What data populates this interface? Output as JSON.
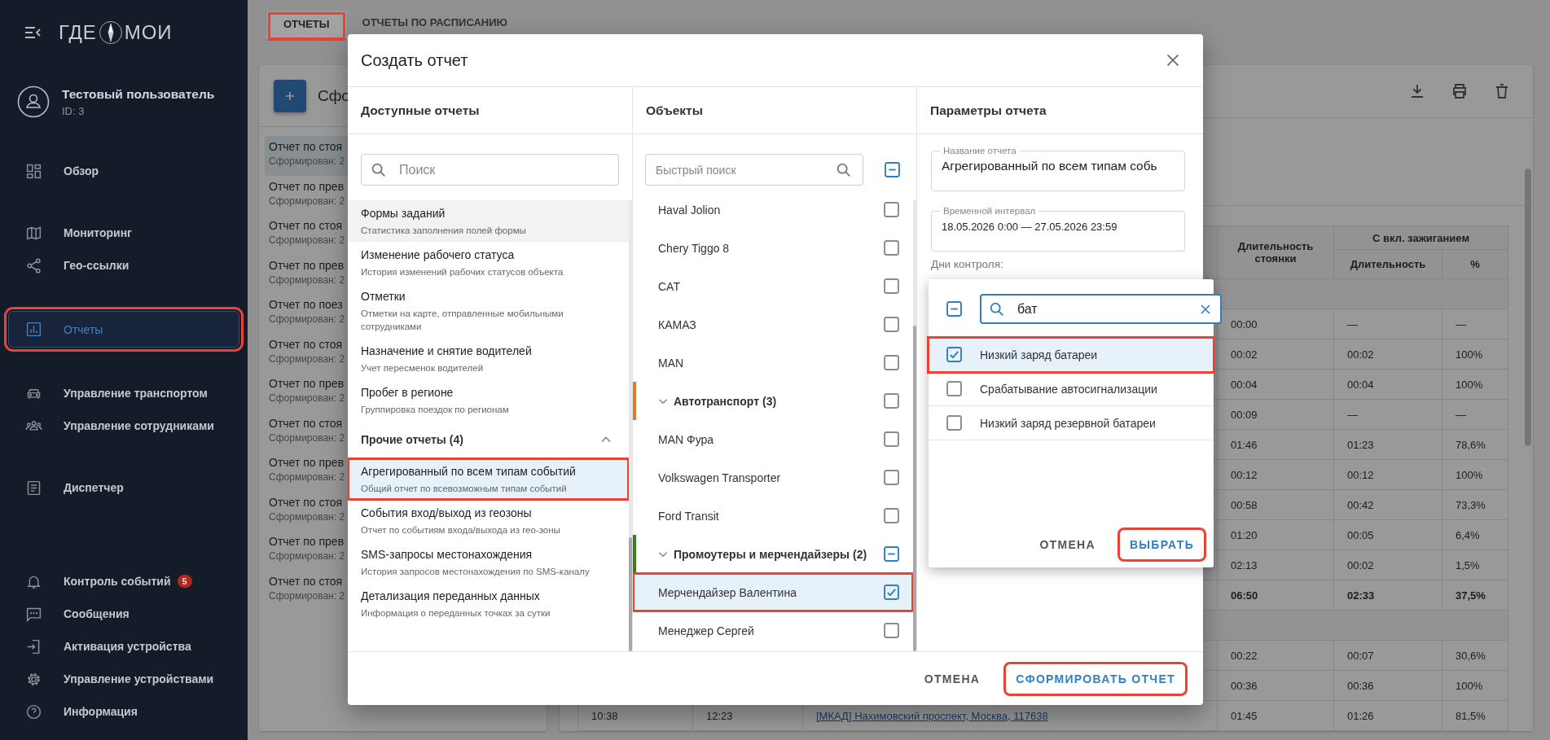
{
  "sidebar": {
    "logo": {
      "left": "ГДЕ",
      "right": "МОИ"
    },
    "user": {
      "name": "Тестовый пользователь",
      "id": "ID: 3"
    },
    "sections": [
      {
        "items": [
          {
            "label": "Обзор",
            "selected": false,
            "highlighted": false
          }
        ]
      },
      {
        "items": [
          {
            "label": "Мониторинг",
            "selected": false,
            "highlighted": false
          },
          {
            "label": "Гео-ссылки",
            "selected": false,
            "highlighted": false
          }
        ]
      },
      {
        "items": [
          {
            "label": "Отчеты",
            "selected": true,
            "highlighted": true
          }
        ]
      },
      {
        "items": [
          {
            "label": "Управление транспортом",
            "selected": false,
            "highlighted": false
          },
          {
            "label": "Управление сотрудниками",
            "selected": false,
            "highlighted": false
          }
        ]
      },
      {
        "items": [
          {
            "label": "Диспетчер",
            "selected": false,
            "highlighted": false
          }
        ]
      }
    ],
    "bottom": {
      "items": [
        {
          "label": "Контроль событий",
          "badge": "5",
          "selected": false,
          "highlighted": false
        },
        {
          "label": "Сообщения",
          "selected": false,
          "highlighted": false
        },
        {
          "label": "Активация устройства",
          "selected": false,
          "highlighted": false
        },
        {
          "label": "Управление устройствами",
          "selected": false,
          "highlighted": false
        },
        {
          "label": "Информация",
          "selected": false,
          "highlighted": false
        }
      ]
    }
  },
  "tabs": [
    {
      "label": "ОТЧЕТЫ",
      "selected": true,
      "highlighted": true
    },
    {
      "label": "ОТЧЕТЫ ПО РАСПИСАНИЮ",
      "selected": false,
      "highlighted": false
    }
  ],
  "reports_panel": {
    "title": "Сфо",
    "items": [
      {
        "title": "Отчет по стоя",
        "subtitle": "Сформирован: 2",
        "selected": true
      },
      {
        "title": "Отчет по прев",
        "subtitle": "Сформирован: 2",
        "selected": false
      },
      {
        "title": "Отчет по стоя",
        "subtitle": "Сформирован: 2",
        "selected": false
      },
      {
        "title": "Отчет по прев",
        "subtitle": "Сформирован: 2",
        "selected": false
      },
      {
        "title": "Отчет по поез",
        "subtitle": "Сформирован: 2",
        "selected": false
      },
      {
        "title": "Отчет по стоя",
        "subtitle": "Сформирован: 2",
        "selected": false
      },
      {
        "title": "Отчет по прев",
        "subtitle": "Сформирован: 2",
        "selected": false
      },
      {
        "title": "Отчет по стоя",
        "subtitle": "Сформирован: 2",
        "selected": false
      },
      {
        "title": "Отчет по прев",
        "subtitle": "Сформирован: 2",
        "selected": false
      },
      {
        "title": "Отчет по стоя",
        "subtitle": "Сформирован: 2",
        "selected": false
      },
      {
        "title": "Отчет по прев",
        "subtitle": "Сформирован: 2",
        "selected": false
      },
      {
        "title": "Отчет по стоя",
        "subtitle": "Сформирован: 2",
        "selected": false
      }
    ]
  },
  "report_table": {
    "header": {
      "parking": "Длительность стоянки",
      "ignition_group": "С вкл. зажиганием",
      "ignition_duration": "Длительность",
      "ignition_percent": "%"
    },
    "rows": [
      {
        "kind": "group"
      },
      {
        "kind": "data",
        "parking": "00:00",
        "ignition": "—",
        "percent": "—"
      },
      {
        "kind": "data",
        "parking": "00:02",
        "ignition": "00:02",
        "percent": "100%"
      },
      {
        "kind": "data",
        "parking": "00:04",
        "ignition": "00:04",
        "percent": "100%"
      },
      {
        "kind": "data",
        "parking": "00:09",
        "ignition": "—",
        "percent": "—"
      },
      {
        "kind": "data",
        "parking": "01:46",
        "ignition": "01:23",
        "percent": "78,6%"
      },
      {
        "kind": "data",
        "parking": "00:12",
        "ignition": "00:12",
        "percent": "100%"
      },
      {
        "kind": "data",
        "parking": "00:58",
        "ignition": "00:42",
        "percent": "73,3%"
      },
      {
        "kind": "data",
        "parking": "01:20",
        "ignition": "00:05",
        "percent": "6,4%"
      },
      {
        "kind": "data",
        "parking": "02:13",
        "ignition": "00:02",
        "percent": "1,5%"
      },
      {
        "kind": "total",
        "parking": "06:50",
        "ignition": "02:33",
        "percent": "37,5%"
      },
      {
        "kind": "group"
      },
      {
        "kind": "data",
        "parking": "00:22",
        "ignition": "00:07",
        "percent": "30,6%"
      },
      {
        "kind": "data",
        "parking": "00:36",
        "ignition": "00:36",
        "percent": "100%"
      },
      {
        "kind": "data",
        "start": "10:38",
        "end": "12:23",
        "address": "[МКАД] Нахимовский проспект, Москва, 117638",
        "parking": "01:45",
        "ignition": "01:26",
        "percent": "81,5%"
      }
    ]
  },
  "dialog": {
    "title": "Создать отчет",
    "reports": {
      "heading": "Доступные отчеты",
      "search": {
        "placeholder": "Поиск"
      },
      "list": [
        {
          "kind": "report",
          "title": "Формы заданий",
          "description": "Статистика заполнения полей формы",
          "hovered": true,
          "selected": false,
          "highlighted": false
        },
        {
          "kind": "report",
          "title": "Изменение рабочего статуса",
          "description": "История изменений рабочих статусов объекта",
          "hovered": false,
          "selected": false,
          "highlighted": false
        },
        {
          "kind": "report",
          "title": "Отметки",
          "description": "Отметки на карте, отправленные мобильными сотрудниками",
          "hovered": false,
          "selected": false,
          "highlighted": false
        },
        {
          "kind": "report",
          "title": "Назначение и снятие водителей",
          "description": "Учет пересменок водителей",
          "hovered": false,
          "selected": false,
          "highlighted": false
        },
        {
          "kind": "report",
          "title": "Пробег в регионе",
          "description": "Группировка поездок по регионам",
          "hovered": false,
          "selected": false,
          "highlighted": false
        },
        {
          "kind": "group",
          "title": "Прочие отчеты (4)",
          "expanded": true,
          "children": [
            {
              "title": "Агрегированный по всем типам событий",
              "description": "Общий отчет по всевозможным типам событий",
              "hovered": false,
              "selected": true,
              "highlighted": true
            },
            {
              "title": "События вход/выход из геозоны",
              "description": "Отчет по событиям входа/выхода из гео-зоны",
              "hovered": false,
              "selected": false,
              "highlighted": false
            },
            {
              "title": "SMS-запросы местонахождения",
              "description": "История запросов местонахождения по SMS-каналу",
              "hovered": false,
              "selected": false,
              "highlighted": false
            },
            {
              "title": "Детализация переданных данных",
              "description": "Информация о переданных точках за сутки",
              "hovered": false,
              "selected": false,
              "highlighted": false
            }
          ]
        }
      ]
    },
    "objects": {
      "heading": "Объекты",
      "search": {
        "placeholder": "Быстрый поиск"
      },
      "select_all": {
        "indeterminate": true
      },
      "list": [
        {
          "kind": "item",
          "label": "Haval Jolion",
          "checked": false,
          "selected": false,
          "highlighted": false
        },
        {
          "kind": "item",
          "label": "Chery Tiggo 8",
          "checked": false,
          "selected": false,
          "highlighted": false
        },
        {
          "kind": "item",
          "label": "CAT",
          "checked": false,
          "selected": false,
          "highlighted": false
        },
        {
          "kind": "item",
          "label": "КАМАЗ",
          "checked": false,
          "selected": false,
          "highlighted": false
        },
        {
          "kind": "item",
          "label": "MAN",
          "checked": false,
          "selected": false,
          "highlighted": false
        },
        {
          "kind": "group",
          "label": "Автотранспорт (3)",
          "color": "#e8772e",
          "checked": false,
          "indeterminate": false,
          "expanded": true,
          "children": [
            {
              "label": "MAN Фура",
              "checked": false,
              "selected": false,
              "highlighted": false
            },
            {
              "label": "Volkswagen Transporter",
              "checked": false,
              "selected": false,
              "highlighted": false
            },
            {
              "label": "Ford Transit",
              "checked": false,
              "selected": false,
              "highlighted": false
            }
          ]
        },
        {
          "kind": "group",
          "label": "Промоутеры и мерчендайзеры (2)",
          "color": "#3a7d1e",
          "indeterminate": true,
          "expanded": true,
          "children": [
            {
              "label": "Мерчендайзер Валентина",
              "checked": true,
              "selected": true,
              "highlighted": true
            },
            {
              "label": "Менеджер Сергей",
              "checked": false,
              "selected": false,
              "highlighted": false
            }
          ]
        }
      ]
    },
    "parameters": {
      "heading": "Параметры отчета",
      "fields": [
        {
          "label": "Название отчета",
          "value": "Агрегированный по всем типам собь"
        },
        {
          "label": "Временной интервал",
          "value": "18.05.2026 0:00 — 27.05.2026 23:59"
        }
      ],
      "control_days_label": "Дни контроля:"
    },
    "buttons": [
      {
        "label": "ОТМЕНА",
        "kind": "secondary",
        "highlighted": false
      },
      {
        "label": "СФОРМИРОВАТЬ ОТЧЕТ",
        "kind": "primary",
        "highlighted": true
      }
    ]
  },
  "event_picker": {
    "select_all": {
      "indeterminate": true
    },
    "search": {
      "value": "бат"
    },
    "options": [
      {
        "label": "Низкий заряд батареи",
        "checked": true,
        "selected": true,
        "highlighted": true
      },
      {
        "label": "Срабатывание автосигнализации",
        "checked": false,
        "selected": false,
        "highlighted": false
      },
      {
        "label": "Низкий заряд резервной батареи",
        "checked": false,
        "selected": false,
        "highlighted": false
      }
    ],
    "buttons": [
      {
        "label": "ОТМЕНА",
        "kind": "secondary",
        "highlighted": false
      },
      {
        "label": "ВЫБРАТЬ",
        "kind": "primary",
        "highlighted": true
      }
    ]
  }
}
